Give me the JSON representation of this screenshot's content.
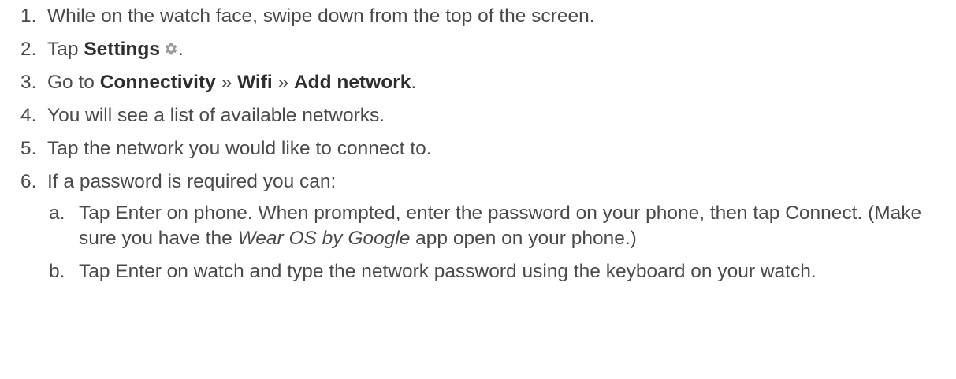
{
  "steps": [
    {
      "num": "1.",
      "text": "While on the watch face, swipe down from the top of the screen."
    },
    {
      "num": "2.",
      "pre": "Tap ",
      "bold": "Settings",
      "icon": "gear-icon",
      "post": "."
    },
    {
      "num": "3.",
      "pre": "Go to ",
      "b1": "Connectivity",
      "sep1": " » ",
      "b2": "Wifi",
      "sep2": " » ",
      "b3": "Add network",
      "post": "."
    },
    {
      "num": "4.",
      "text": "You will see a list of available networks."
    },
    {
      "num": "5.",
      "text": "Tap the network you would like to connect to."
    },
    {
      "num": "6.",
      "text": "If a password is required you can:"
    }
  ],
  "substeps": [
    {
      "letter": "a.",
      "pre": "Tap Enter on phone. When prompted, enter the password on your phone, then tap Connect. (Make sure you have the ",
      "italic": "Wear OS by Google",
      "post": " app open on your phone.)"
    },
    {
      "letter": "b.",
      "text": "Tap Enter on watch and type the network password using the keyboard on your watch."
    }
  ],
  "colors": {
    "text": "#4a4a4a",
    "bold": "#2e2e2e",
    "icon": "#9b9b9b"
  }
}
